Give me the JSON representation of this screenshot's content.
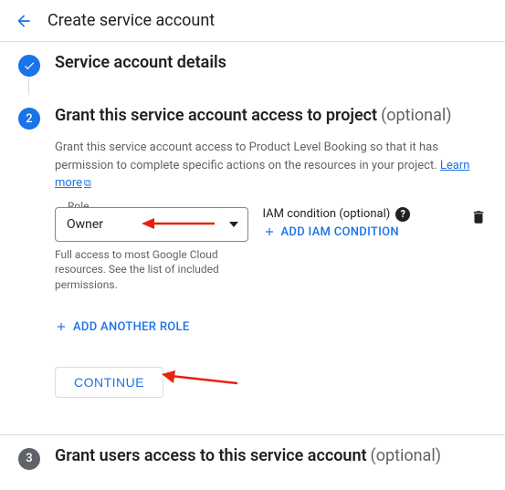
{
  "header": {
    "title": "Create service account"
  },
  "step1": {
    "title": "Service account details"
  },
  "step2": {
    "number": "2",
    "title": "Grant this service account access to project",
    "optional": "(optional)",
    "description": "Grant this service account access to Product Level Booking so that it has permission to complete specific actions on the resources in your project. ",
    "learn_more": "Learn more",
    "role_label": "Role",
    "role_value": "Owner",
    "role_help": "Full access to most Google Cloud resources. See the list of included permissions.",
    "iam_label": "IAM condition (optional)",
    "add_condition": "ADD IAM CONDITION",
    "add_role": "ADD ANOTHER ROLE",
    "continue": "CONTINUE"
  },
  "step3": {
    "number": "3",
    "title": "Grant users access to this service account",
    "optional": "(optional)"
  }
}
